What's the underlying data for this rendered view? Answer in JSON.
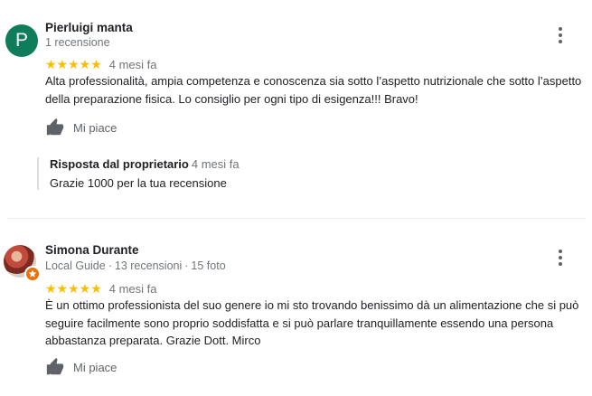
{
  "reviews": [
    {
      "avatar_letter": "P",
      "author": "Pierluigi manta",
      "meta": "1 recensione",
      "stars": "★★★★★",
      "rating": 5,
      "time": "4 mesi fa",
      "text": "Alta professionalità, ampia competenza e conoscenza sia sotto l’aspetto nutrizionale che sotto l’aspetto della preparazione fisica. Lo consiglio per ogni tipo di esigenza!!! Bravo!",
      "like_label": "Mi piace",
      "reply": {
        "title": "Risposta dal proprietario",
        "time": "4 mesi fa",
        "text": "Grazie 1000 per la tua recensione"
      }
    },
    {
      "author": "Simona Durante",
      "meta_badge": "Local Guide",
      "meta_reviews": "13 recensioni",
      "meta_photos": "15 foto",
      "meta_sep": "·",
      "stars": "★★★★★",
      "rating": 5,
      "time": "4 mesi fa",
      "text": "È un ottimo professionista del suo genere io mi sto trovando benissimo dà un alimentazione che si può seguire facilmente sono proprio soddisfatta e si può parlare tranquillamente essendo una persona abbastanza preparata. Grazie Dott. Mirco",
      "like_label": "Mi piace"
    }
  ],
  "colors": {
    "star": "#fbbc04",
    "avatar_bg": "#0f7d5a",
    "local_guide_badge": "#e8710a",
    "secondary_text": "#70757a"
  },
  "icons": {
    "menu": "more-vert-icon",
    "like": "thumb-up-icon",
    "badge": "local-guide-star-icon"
  }
}
